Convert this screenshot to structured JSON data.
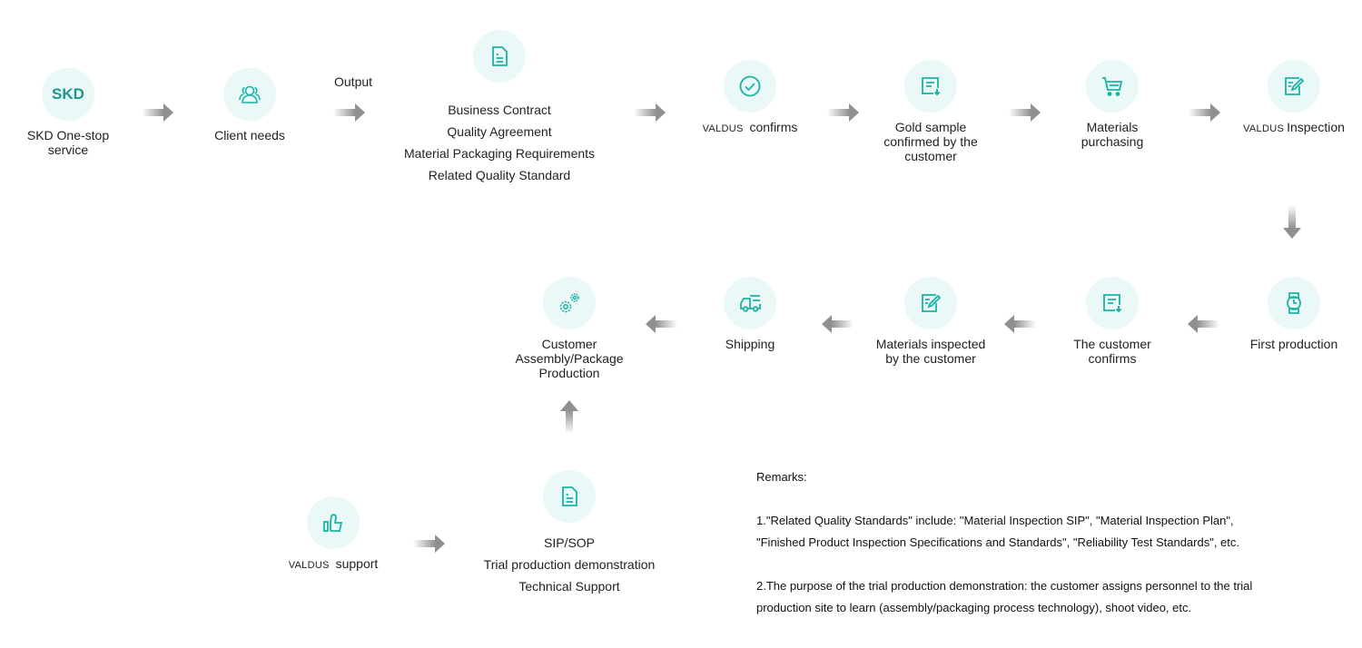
{
  "colors": {
    "accent": "#1ab3a6",
    "circle_bg": "#eaf8f7",
    "arrow": "#8f8f8f",
    "text": "#222222"
  },
  "nodes": {
    "skd": {
      "logo_text": "SKD",
      "label": "SKD One-stop service",
      "icon": "skd-logo"
    },
    "client_needs": {
      "label": "Client needs",
      "icon": "users-icon"
    },
    "output_label": "Output",
    "documents": {
      "icon": "document-icon",
      "lines": [
        "Business Contract",
        "Quality Agreement",
        "Material Packaging Requirements",
        "Related Quality Standard"
      ]
    },
    "valdus_confirms": {
      "brand": "VALDUS",
      "label": "confirms",
      "icon": "check-circle-icon"
    },
    "gold_sample": {
      "label": "Gold sample confirmed by the customer",
      "icon": "document-download-icon"
    },
    "materials_purchasing": {
      "label": "Materials purchasing",
      "icon": "cart-icon"
    },
    "valdus_inspection": {
      "brand": "VALDUS",
      "label": "Inspection",
      "icon": "edit-document-icon"
    },
    "first_production": {
      "label": "First production",
      "icon": "watch-icon"
    },
    "customer_confirms": {
      "label": "The customer confirms",
      "icon": "document-download-icon"
    },
    "materials_inspected": {
      "label": "Materials inspected by the customer",
      "icon": "edit-document-icon"
    },
    "shipping": {
      "label": "Shipping",
      "icon": "truck-icon"
    },
    "assembly": {
      "label": "Customer Assembly/Package Production",
      "icon": "gears-icon"
    },
    "valdus_support": {
      "brand": "VALDUS",
      "label": "support",
      "icon": "thumbs-up-icon"
    },
    "sip_sop": {
      "icon": "document-icon",
      "lines": [
        "SIP/SOP",
        "Trial production demonstration",
        "Technical Support"
      ]
    }
  },
  "remarks": {
    "title": "Remarks:",
    "items": [
      "1.\"Related Quality Standards\" include: \"Material Inspection SIP\", \"Material Inspection Plan\",",
      "\"Finished Product Inspection Specifications and Standards\", \"Reliability Test Standards\", etc.",
      "2.The purpose of the trial production demonstration: the customer assigns personnel to the trial",
      "production site to learn (assembly/packaging process technology), shoot video, etc."
    ]
  }
}
